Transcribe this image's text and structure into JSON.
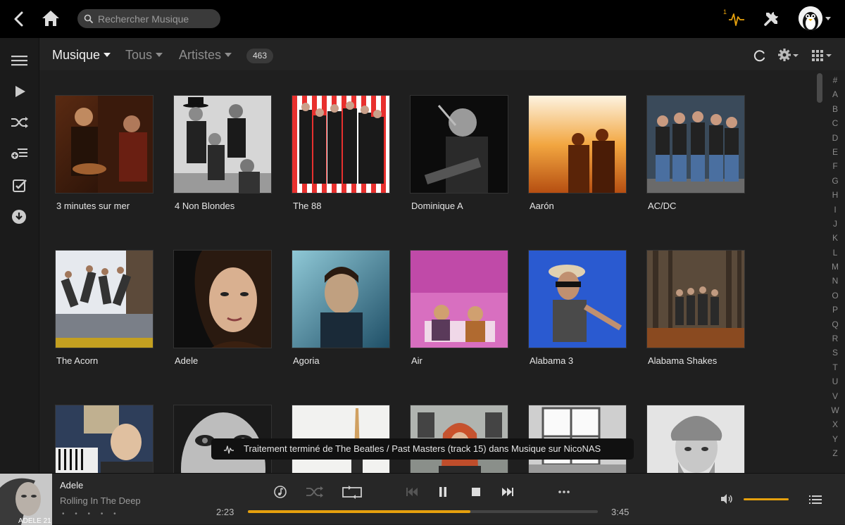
{
  "topbar": {
    "search_placeholder": "Rechercher Musique",
    "activity_count": "1",
    "icons": [
      "back-icon",
      "home-icon",
      "search-icon",
      "activity-icon",
      "tools-icon",
      "avatar",
      "chevron-down-icon"
    ]
  },
  "sidebar": {
    "items": [
      {
        "icon": "menu-icon"
      },
      {
        "icon": "play-icon"
      },
      {
        "icon": "shuffle-icon"
      },
      {
        "icon": "add-playlist-icon"
      },
      {
        "icon": "checkbox-icon"
      },
      {
        "icon": "download-icon"
      }
    ]
  },
  "header": {
    "section": "Musique",
    "filter": "Tous",
    "type": "Artistes",
    "count": "463"
  },
  "artists": [
    {
      "name": "3 minutes sur mer"
    },
    {
      "name": "4 Non Blondes"
    },
    {
      "name": "The 88"
    },
    {
      "name": "Dominique A"
    },
    {
      "name": "Aarón"
    },
    {
      "name": "AC/DC"
    },
    {
      "name": "The Acorn"
    },
    {
      "name": "Adele"
    },
    {
      "name": "Agoria"
    },
    {
      "name": "Air"
    },
    {
      "name": "Alabama 3"
    },
    {
      "name": "Alabama Shakes"
    },
    {
      "name": ""
    },
    {
      "name": ""
    },
    {
      "name": ""
    },
    {
      "name": ""
    },
    {
      "name": ""
    },
    {
      "name": ""
    }
  ],
  "alphabet": [
    "#",
    "A",
    "B",
    "C",
    "D",
    "E",
    "F",
    "G",
    "H",
    "I",
    "J",
    "K",
    "L",
    "M",
    "N",
    "O",
    "P",
    "Q",
    "R",
    "S",
    "T",
    "U",
    "V",
    "W",
    "X",
    "Y",
    "Z"
  ],
  "toast": {
    "message": "Traitement terminé de The Beatles / Past Masters (track 15) dans Musique sur NicoNAS"
  },
  "player": {
    "artist": "Adele",
    "title": "Rolling In The Deep",
    "cover_text": "ADELE 21",
    "rating": "• • • • •",
    "elapsed": "2:23",
    "duration": "3:45",
    "progress": 0.636,
    "volume": 1.0
  },
  "colors": {
    "accent": "#e5a00d",
    "background": "#1f1f1f",
    "topbar": "#000000"
  }
}
